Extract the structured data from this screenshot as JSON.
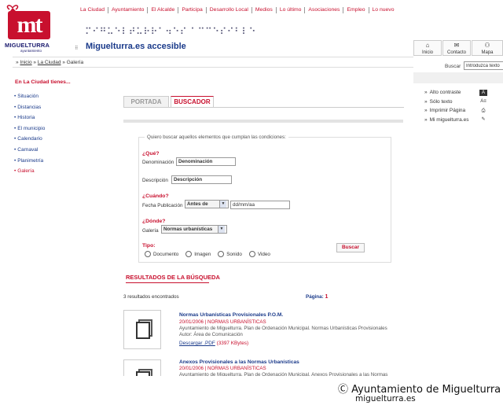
{
  "logo": {
    "title": "MIGUELTURRA",
    "subtitle": "ayuntamiento",
    "mark": "mt"
  },
  "topnav": [
    "La Ciudad",
    "Ayuntamiento",
    "El Alcalde",
    "Participa",
    "Desarrollo Local",
    "Medios",
    "Lo último",
    "Asociaciones",
    "Empleo",
    "Lo nuevo"
  ],
  "braille": "⠍⠊⠛⠥⠑⠇⠞⠥⠗⠗⠁⠲⠑⠎ ⠁⠉⠉⠑⠎⠊⠃⠇⠑",
  "site_title": "Miguelturra.es accesible",
  "tools": [
    {
      "label": "Inicio",
      "icon": "home-icon"
    },
    {
      "label": "Contacto",
      "icon": "mail-icon"
    },
    {
      "label": "Mapa",
      "icon": "sitemap-icon"
    }
  ],
  "search": {
    "label": "Buscar",
    "placeholder": "Introduzca texto"
  },
  "breadcrumb": {
    "items": [
      "Inicio",
      "La Ciudad",
      "Galería"
    ],
    "sep": "»"
  },
  "left": {
    "heading": "En La Ciudad tienes...",
    "items": [
      "Situación",
      "Distancias",
      "Historia",
      "El municipio",
      "Calendario",
      "Carnaval",
      "Planimetría",
      "Galería"
    ]
  },
  "right_options": [
    {
      "label": "Alto contraste",
      "icon": "contrast-icon",
      "glyph": "A"
    },
    {
      "label": "Sólo texto",
      "icon": "text-only-icon",
      "glyph": "A≡"
    },
    {
      "label": "Imprimir Página",
      "icon": "print-icon",
      "glyph": "⎙"
    },
    {
      "label": "Mi miguelturra.es",
      "icon": "pencil-icon",
      "glyph": "✎"
    }
  ],
  "tabs": {
    "portada": "PORTADA",
    "buscador": "BUSCADOR"
  },
  "form": {
    "legend": "Quiero buscar aquellos elementos que cumplan las condiciones:",
    "que": "¿Qué?",
    "denominacion_label": "Denominación",
    "denominacion_value": "Denominación",
    "descripcion_label": "Descripción",
    "descripcion_value": "Descripción",
    "cuando": "¿Cuándo?",
    "fecha_label": "Fecha Publicación",
    "fecha_select": "Antes de",
    "fecha_value": "dd/mm/aa",
    "donde": "¿Dónde?",
    "galeria_label": "Galería",
    "galeria_select": "Normas urbanísticas",
    "tipo": "Tipo:",
    "tipos": [
      "Documento",
      "Imagen",
      "Sonido",
      "Video"
    ],
    "submit": "Buscar"
  },
  "results": {
    "title": "RESULTADOS DE LA BÚSQUEDA",
    "count": "3 resultados encontrados",
    "pagina_label": "Página:",
    "pagina_num": "1",
    "items": [
      {
        "title": "Normas Urbanísticas Provisionales P.O.M.",
        "date": "20/01/2006 | NORMAS URBANÍSTICAS",
        "desc1": "Ayuntamiento de Miguelturra. Plan de Ordenación Municipal. Normas Urbanísticas Provisionales",
        "desc2": "Autor: Área de Comunicación",
        "download": "Descargar .PDF",
        "size": "(3397 KBytes)"
      },
      {
        "title": "Anexos Provisionales a las Normas Urbanísticas",
        "date": "20/01/2006 | NORMAS URBANÍSTICAS",
        "desc1": "Ayuntamiento de Miguelturra. Plan de Ordenación Municipal. Anexos Provisionales a las Normas"
      }
    ]
  },
  "caption": {
    "line1": "Ⓒ Ayuntamiento de Miguelturra",
    "line2": "miguelturra.es"
  },
  "colors": {
    "accent": "#c8102e",
    "link": "#1a3a8a"
  }
}
